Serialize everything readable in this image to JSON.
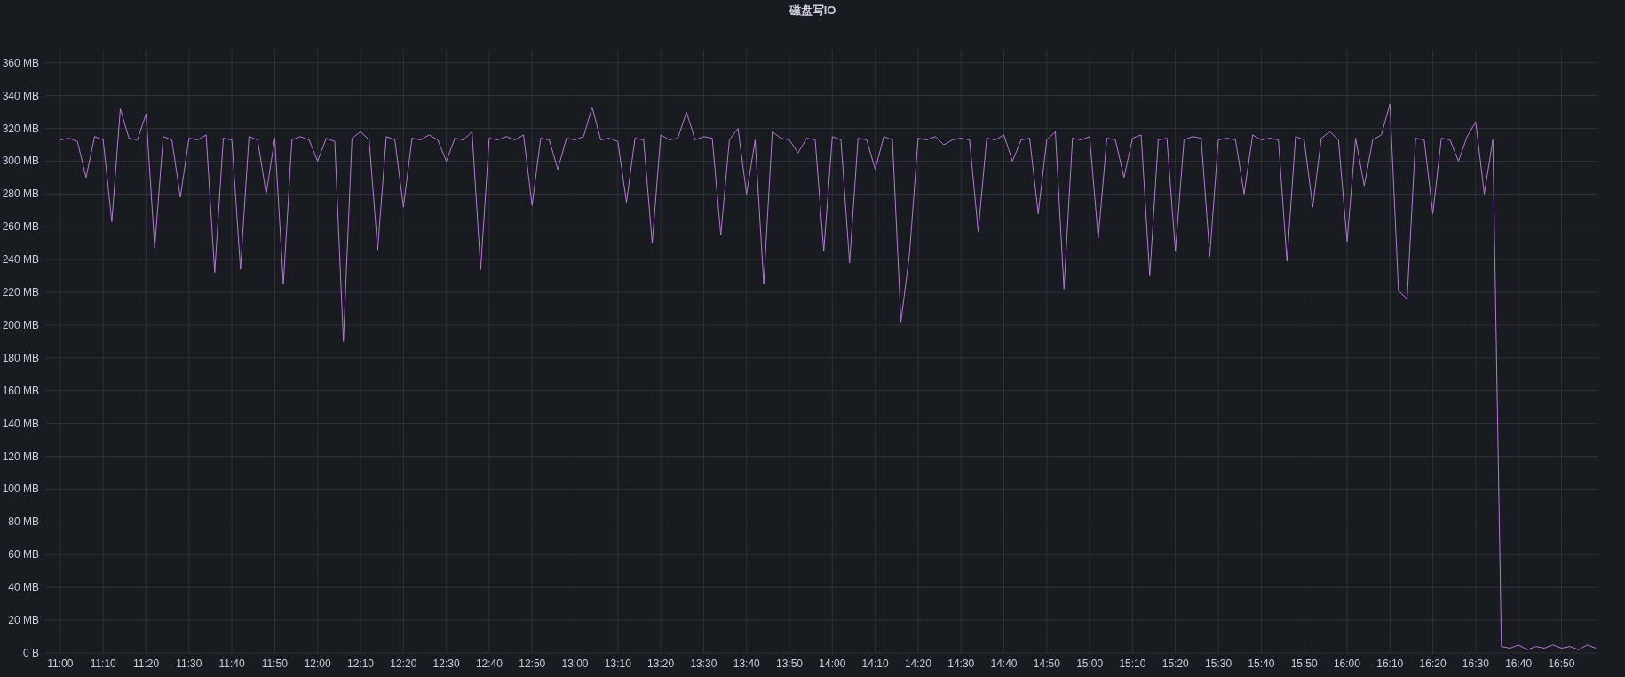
{
  "panel": {
    "title": "磁盘写IO",
    "chart_data": {
      "type": "line",
      "grid": true,
      "ylim": [
        0,
        368
      ],
      "categories": [
        "11:00",
        null,
        null,
        null,
        null,
        "11:10",
        null,
        null,
        null,
        null,
        "11:20",
        null,
        null,
        null,
        null,
        "11:30",
        null,
        null,
        null,
        null,
        "11:40",
        null,
        null,
        null,
        null,
        "11:50",
        null,
        null,
        null,
        null,
        "12:00",
        null,
        null,
        null,
        null,
        "12:10",
        null,
        null,
        null,
        null,
        "12:20",
        null,
        null,
        null,
        null,
        "12:30",
        null,
        null,
        null,
        null,
        "12:40",
        null,
        null,
        null,
        null,
        "12:50",
        null,
        null,
        null,
        null,
        "13:00",
        null,
        null,
        null,
        null,
        "13:10",
        null,
        null,
        null,
        null,
        "13:20",
        null,
        null,
        null,
        null,
        "13:30",
        null,
        null,
        null,
        null,
        "13:40",
        null,
        null,
        null,
        null,
        "13:50",
        null,
        null,
        null,
        null,
        "14:00",
        null,
        null,
        null,
        null,
        "14:10",
        null,
        null,
        null,
        null,
        "14:20",
        null,
        null,
        null,
        null,
        "14:30",
        null,
        null,
        null,
        null,
        "14:40",
        null,
        null,
        null,
        null,
        "14:50",
        null,
        null,
        null,
        null,
        "15:00",
        null,
        null,
        null,
        null,
        "15:10",
        null,
        null,
        null,
        null,
        "15:20",
        null,
        null,
        null,
        null,
        "15:30",
        null,
        null,
        null,
        null,
        "15:40",
        null,
        null,
        null,
        null,
        "15:50",
        null,
        null,
        null,
        null,
        "16:00",
        null,
        null,
        null,
        null,
        "16:10",
        null,
        null,
        null,
        null,
        "16:20",
        null,
        null,
        null,
        null,
        "16:30",
        null,
        null,
        null,
        null,
        "16:40",
        null,
        null,
        null,
        null,
        "16:50",
        null,
        null,
        null,
        null
      ],
      "yticks": [
        {
          "value": 0,
          "label": "0 B"
        },
        {
          "value": 20,
          "label": "20 MB"
        },
        {
          "value": 40,
          "label": "40 MB"
        },
        {
          "value": 60,
          "label": "60 MB"
        },
        {
          "value": 80,
          "label": "80 MB"
        },
        {
          "value": 100,
          "label": "100 MB"
        },
        {
          "value": 120,
          "label": "120 MB"
        },
        {
          "value": 140,
          "label": "140 MB"
        },
        {
          "value": 160,
          "label": "160 MB"
        },
        {
          "value": 180,
          "label": "180 MB"
        },
        {
          "value": 200,
          "label": "200 MB"
        },
        {
          "value": 220,
          "label": "220 MB"
        },
        {
          "value": 240,
          "label": "240 MB"
        },
        {
          "value": 260,
          "label": "260 MB"
        },
        {
          "value": 280,
          "label": "280 MB"
        },
        {
          "value": 300,
          "label": "300 MB"
        },
        {
          "value": 320,
          "label": "320 MB"
        },
        {
          "value": 340,
          "label": "340 MB"
        },
        {
          "value": 360,
          "label": "360 MB"
        }
      ],
      "series": [
        {
          "color": "#b877d9",
          "values": [
            313,
            314,
            312,
            290,
            315,
            313,
            263,
            332,
            314,
            313,
            329,
            247,
            315,
            313,
            278,
            314,
            313,
            316,
            232,
            314,
            313,
            234,
            315,
            313,
            280,
            314,
            225,
            313,
            315,
            313,
            300,
            314,
            312,
            190,
            314,
            318,
            313,
            246,
            315,
            313,
            272,
            314,
            313,
            316,
            313,
            300,
            314,
            313,
            318,
            234,
            314,
            313,
            315,
            313,
            316,
            273,
            314,
            313,
            295,
            314,
            313,
            315,
            333,
            313,
            314,
            312,
            275,
            314,
            313,
            250,
            316,
            313,
            314,
            330,
            313,
            315,
            314,
            255,
            313,
            320,
            280,
            313,
            225,
            318,
            314,
            313,
            305,
            314,
            313,
            245,
            315,
            313,
            238,
            314,
            313,
            295,
            315,
            313,
            202,
            244,
            314,
            313,
            315,
            310,
            313,
            314,
            313,
            257,
            314,
            313,
            316,
            300,
            313,
            314,
            268,
            313,
            318,
            222,
            314,
            313,
            315,
            253,
            314,
            313,
            290,
            314,
            316,
            230,
            313,
            314,
            245,
            313,
            315,
            314,
            242,
            313,
            314,
            313,
            280,
            316,
            313,
            314,
            313,
            239,
            315,
            313,
            272,
            314,
            318,
            313,
            251,
            314,
            285,
            313,
            316,
            335,
            221,
            216,
            314,
            313,
            268,
            314,
            313,
            300,
            315,
            324,
            280,
            313,
            4,
            3,
            5,
            2,
            4,
            3,
            5,
            3,
            4,
            2,
            5,
            3
          ]
        }
      ]
    }
  }
}
